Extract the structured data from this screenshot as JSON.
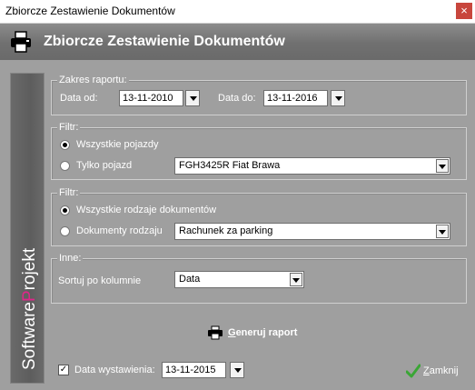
{
  "window": {
    "title": "Zbiorcze Zestawienie Dokumentów",
    "close_glyph": "×"
  },
  "header": {
    "title": "Zbiorcze Zestawienie Dokumentów",
    "icon": "printer-icon"
  },
  "sidebar": {
    "brand_text": "SoftwareProjekt",
    "brand_part1": "Software",
    "brand_highlight": "P",
    "brand_part2": "rojekt",
    "highlight_color": "#e0268a"
  },
  "zakres": {
    "legend": "Zakres raportu:",
    "date_from_label": "Data od:",
    "date_from_value": "13-11-2010",
    "date_to_label": "Data do:",
    "date_to_value": "13-11-2016"
  },
  "filter_vehicle": {
    "legend": "Filtr:",
    "all_label": "Wszystkie pojazdy",
    "only_label": "Tylko pojazd",
    "vehicle_value": "FGH3425R Fiat Brawa"
  },
  "filter_docs": {
    "legend": "Filtr:",
    "all_label": "Wszystkie rodzaje dokumentów",
    "type_label": "Dokumenty rodzaju",
    "type_value": "Rachunek za parking"
  },
  "other": {
    "legend": "Inne:",
    "sort_label": "Sortuj po kolumnie",
    "sort_value": "Data"
  },
  "generate": {
    "label_prefix": "G",
    "label_rest": "eneruj raport",
    "icon": "printer-icon"
  },
  "issue_date": {
    "label": "Data wystawienia:",
    "value": "13-11-2015",
    "checked": true
  },
  "close_button": {
    "label_prefix": "Z",
    "label_rest": "amknij",
    "icon": "checkmark-icon",
    "accent": "#3aa635"
  }
}
